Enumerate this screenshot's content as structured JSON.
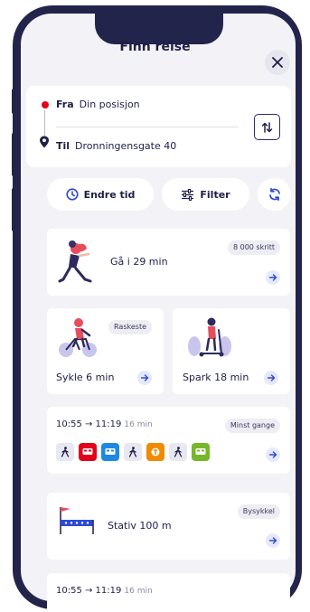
{
  "header": {
    "title": "Finn reise"
  },
  "search": {
    "from_label": "Fra",
    "from_value": "Din posisjon",
    "to_label": "Til",
    "to_value": "Dronningensgate 40"
  },
  "actions": {
    "time_label": "Endre tid",
    "filter_label": "Filter"
  },
  "walk": {
    "title": "Gå i 29 min",
    "steps": "8 000 skritt"
  },
  "bike": {
    "title": "Sykle 6 min",
    "badge": "Raskeste"
  },
  "scooter": {
    "title": "Spark 18 min"
  },
  "trip1": {
    "time": "10:55 → 11:19",
    "duration": "16 min",
    "badge": "Minst gange",
    "legs": [
      {
        "type": "walk",
        "color": "#e8e8f1"
      },
      {
        "type": "bus",
        "color": "#e3001b"
      },
      {
        "type": "bus",
        "color": "#1e88e5"
      },
      {
        "type": "walk",
        "color": "#e8e8f1"
      },
      {
        "type": "tram",
        "color": "#f08a00"
      },
      {
        "type": "walk",
        "color": "#e8e8f1"
      },
      {
        "type": "bus",
        "color": "#76b82a"
      }
    ]
  },
  "citybike": {
    "title": "Stativ 100 m",
    "badge": "Bysykkel"
  },
  "trip2": {
    "time": "10:55 → 11:19",
    "duration": "16 min"
  },
  "colors": {
    "frame": "#22244b",
    "accent": "#2d4ad6",
    "bg": "#f3f3f7"
  }
}
